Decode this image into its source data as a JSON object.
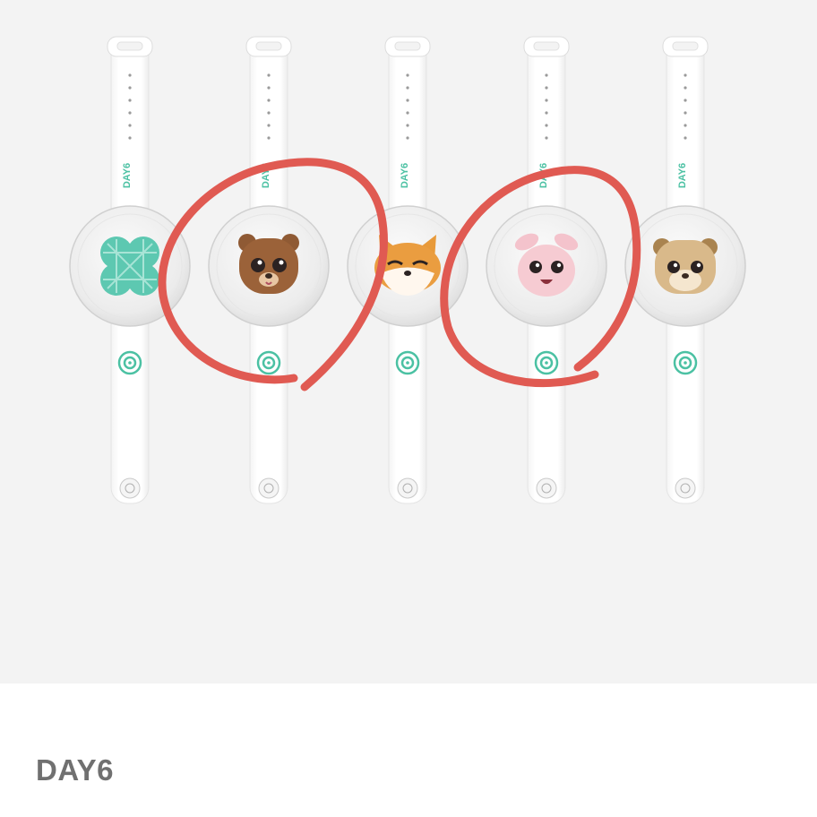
{
  "product": {
    "brand_name": "DAY6",
    "strap_print": "DAY6",
    "bands": [
      {
        "charm": "clover-charm-icon",
        "circled": false
      },
      {
        "charm": "bear-charm-icon",
        "circled": true
      },
      {
        "charm": "fox-charm-icon",
        "circled": false
      },
      {
        "charm": "bunny-charm-icon",
        "circled": true
      },
      {
        "charm": "puppy-charm-icon",
        "circled": false
      }
    ]
  },
  "colors": {
    "background": "#f3f3f3",
    "caption_bg": "#ffffff",
    "strap": "#ffffff",
    "accent_teal": "#4bc1a3",
    "annotation_red": "#e05a52",
    "title_text": "#707070"
  }
}
